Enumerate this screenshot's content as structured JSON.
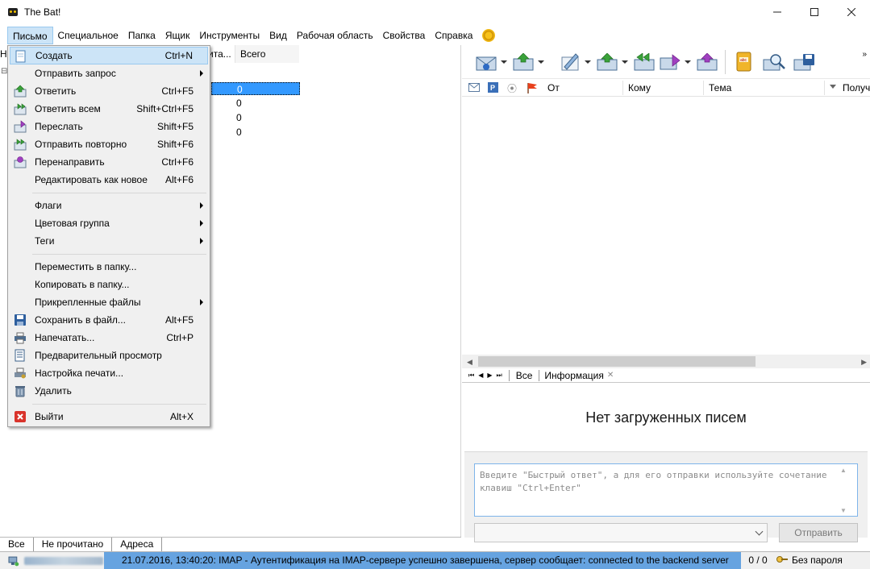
{
  "window": {
    "title": "The Bat!"
  },
  "window_controls": {
    "minimize": "—",
    "maximize": "☐",
    "close": "✕"
  },
  "menubar": {
    "items": [
      "Письмо",
      "Специальное",
      "Папка",
      "Ящик",
      "Инструменты",
      "Вид",
      "Рабочая область",
      "Свойства",
      "Справка"
    ],
    "active_index": 0
  },
  "folder_columns": {
    "unread_partial": "ита...",
    "total": "Всего",
    "partial_left": "Н"
  },
  "folders": [
    {
      "count": "0",
      "selected": true
    },
    {
      "count": "0",
      "selected": false
    },
    {
      "count": "0",
      "selected": false
    },
    {
      "count": "0",
      "selected": false
    }
  ],
  "folder_tabs": [
    "Все",
    "Не прочитано",
    "Адреса"
  ],
  "dropdown": {
    "items": [
      {
        "label": "Создать",
        "shortcut": "Ctrl+N",
        "icon": "new-message-icon",
        "highlighted": true
      },
      {
        "label": "Отправить запрос",
        "shortcut": "",
        "submenu": true
      },
      {
        "label": "Ответить",
        "shortcut": "Ctrl+F5",
        "icon": "reply-icon"
      },
      {
        "label": "Ответить всем",
        "shortcut": "Shift+Ctrl+F5",
        "icon": "reply-all-icon"
      },
      {
        "label": "Переслать",
        "shortcut": "Shift+F5",
        "icon": "forward-icon"
      },
      {
        "label": "Отправить повторно",
        "shortcut": "Shift+F6",
        "icon": "resend-icon"
      },
      {
        "label": "Перенаправить",
        "shortcut": "Ctrl+F6",
        "icon": "redirect-icon"
      },
      {
        "label": "Редактировать как новое",
        "shortcut": "Alt+F6"
      },
      {
        "label": "Флаги",
        "shortcut": "",
        "submenu": true
      },
      {
        "label": "Цветовая группа",
        "shortcut": "",
        "submenu": true
      },
      {
        "label": "Теги",
        "shortcut": "",
        "submenu": true
      },
      {
        "label": "Переместить в папку...",
        "shortcut": ""
      },
      {
        "label": "Копировать в папку...",
        "shortcut": ""
      },
      {
        "label": "Прикрепленные файлы",
        "shortcut": "",
        "submenu": true
      },
      {
        "label": "Сохранить в файл...",
        "shortcut": "Alt+F5",
        "icon": "save-icon"
      },
      {
        "label": "Напечатать...",
        "shortcut": "Ctrl+P",
        "icon": "print-icon"
      },
      {
        "label": "Предварительный просмотр",
        "shortcut": "",
        "icon": "print-preview-icon"
      },
      {
        "label": "Настройка печати...",
        "shortcut": "",
        "icon": "print-setup-icon"
      },
      {
        "label": "Удалить",
        "shortcut": "",
        "icon": "trash-icon"
      },
      {
        "label": "Выйти",
        "shortcut": "Alt+X",
        "icon": "exit-icon"
      }
    ]
  },
  "message_list": {
    "columns": [
      "От",
      "Кому",
      "Тема",
      "Получ"
    ]
  },
  "view_tabs": [
    "Все",
    "Информация"
  ],
  "empty_state": "Нет загруженных писем",
  "quick_reply": {
    "placeholder": "Введите \"Быстрый ответ\", а для его отправки используйте сочетание клавиш \"Ctrl+Enter\"",
    "send_label": "Отправить"
  },
  "statusbar": {
    "log": "21.07.2016, 13:40:20: IMAP - Аутентификация на IMAP-сервере успешно завершена, сервер сообщает: connected to the backend server",
    "counts": "0 / 0",
    "password": "Без пароля"
  },
  "colors": {
    "accent": "#3399ff",
    "menu_highlight": "#cce4f7",
    "status_log": "#66a3e0"
  }
}
